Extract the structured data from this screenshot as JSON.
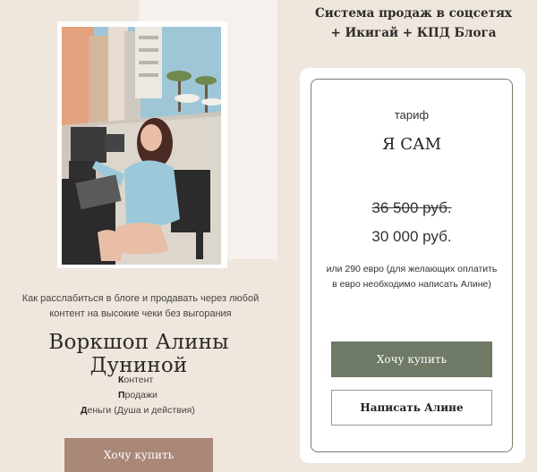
{
  "left": {
    "subtitle": "Как расслабиться в блоге и продавать через любой контент на высокие чеки без выгорания",
    "workshop_title": "Воркшоп Алины Дуниной",
    "pillars": [
      {
        "initial": "К",
        "rest": "онтент"
      },
      {
        "initial": "П",
        "rest": "родажи"
      },
      {
        "initial": "Д",
        "rest": "еньги (Душа и действия)"
      }
    ],
    "buy_label": "Хочу купить"
  },
  "header": {
    "title_line1": "Система продаж в соцсетях",
    "title_line2": "+ Икигай + КПД Блога"
  },
  "card": {
    "tariff_label": "тариф",
    "plan_name": "Я САМ",
    "old_price": "36 500 руб.",
    "new_price": "30 000 руб.",
    "euro_note": "или 290 евро (для желающих оплатить в евро необходимо написать Алине)",
    "buy_label": "Хочу купить",
    "write_label": "Написать Алине"
  },
  "colors": {
    "page_bg": "#efe6dd",
    "left_button": "#a98877",
    "card_button": "#6e7966"
  }
}
